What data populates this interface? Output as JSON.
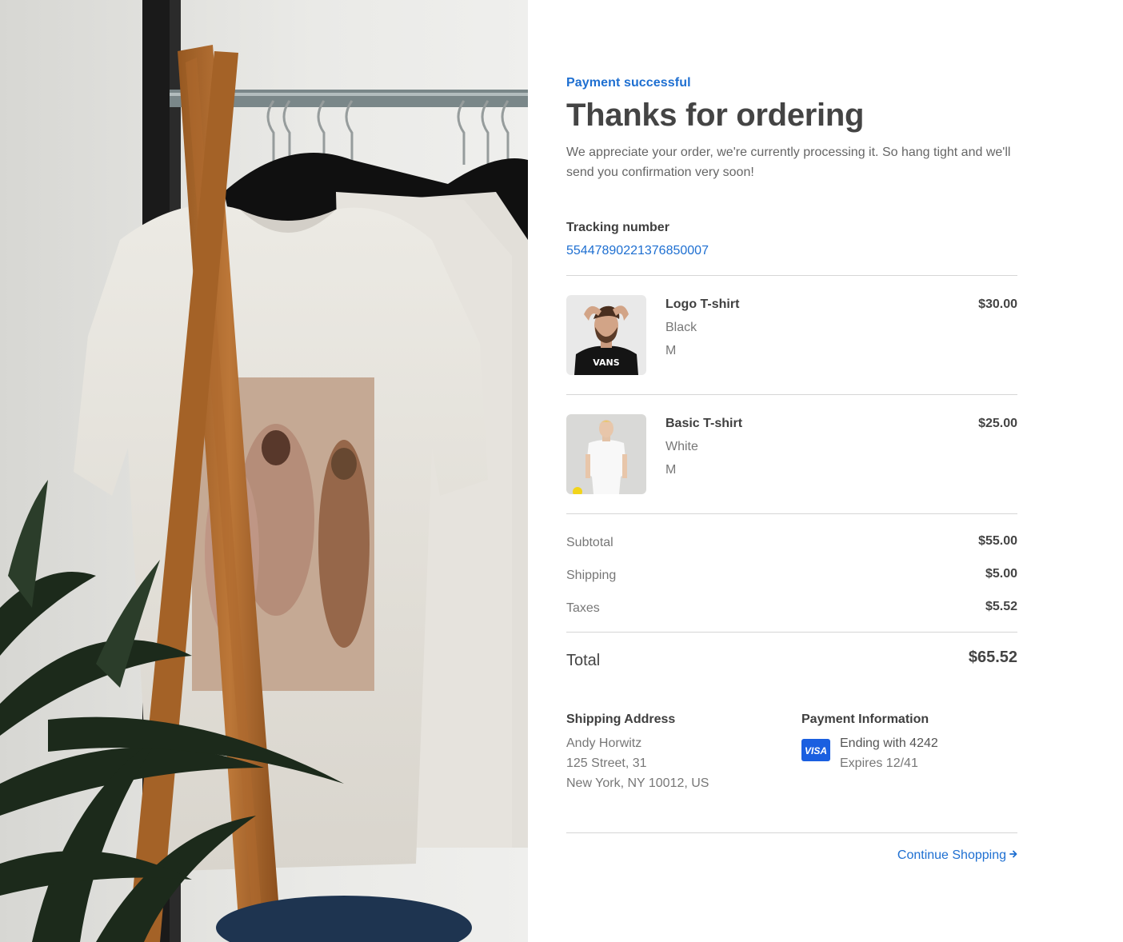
{
  "hero": {
    "image_icon": "clothing-rack-photo-icon"
  },
  "order": {
    "status": "Payment successful",
    "title": "Thanks for ordering",
    "message": "We appreciate your order, we're currently processing it. So hang tight and we'll send you confirmation very soon!",
    "tracking_label": "Tracking number",
    "tracking_number": "55447890221376850007"
  },
  "items": [
    {
      "name": "Logo T-shirt",
      "color": "Black",
      "size": "M",
      "price": "$30.00",
      "image_icon": "man-black-tshirt-photo-icon"
    },
    {
      "name": "Basic T-shirt",
      "color": "White",
      "size": "M",
      "price": "$25.00",
      "image_icon": "man-white-tshirt-photo-icon"
    }
  ],
  "summary": {
    "subtotal_label": "Subtotal",
    "subtotal_value": "$55.00",
    "shipping_label": "Shipping",
    "shipping_value": "$5.00",
    "taxes_label": "Taxes",
    "taxes_value": "$5.52",
    "total_label": "Total",
    "total_value": "$65.52"
  },
  "shipping_address": {
    "title": "Shipping Address",
    "name": "Andy Horwitz",
    "street": "125 Street, 31",
    "city": "New York, NY 10012, US"
  },
  "payment": {
    "title": "Payment Information",
    "card_icon": "visa-card-icon",
    "card_brand": "VISA",
    "ending": "Ending with 4242",
    "expires": "Expires 12/41"
  },
  "actions": {
    "continue_label": "Continue Shopping",
    "continue_icon": "arrow-right-icon"
  },
  "colors": {
    "accent": "#1e6fd1",
    "visa_blue": "#1a5fe0"
  }
}
